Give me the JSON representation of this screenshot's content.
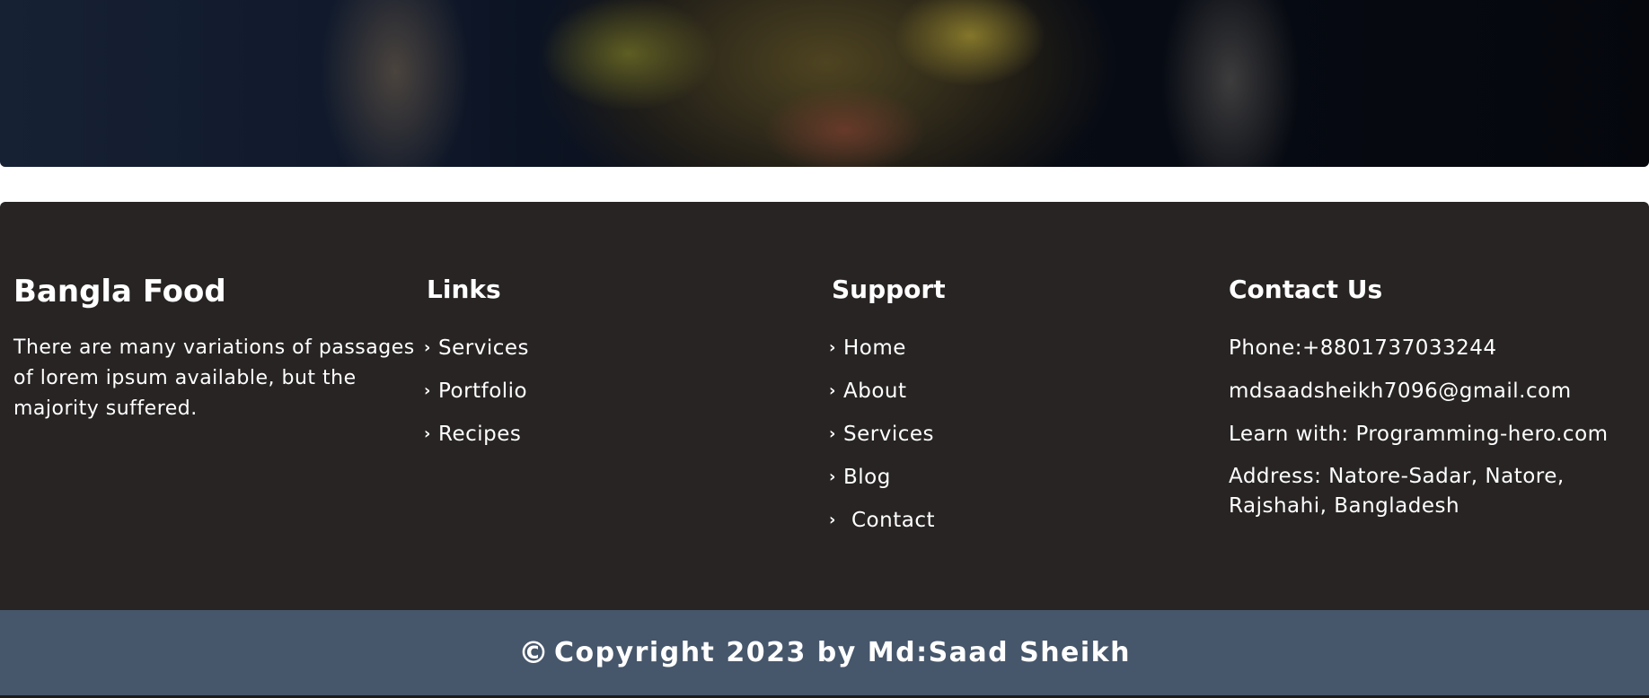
{
  "footer": {
    "brand": {
      "title": "Bangla Food",
      "description": "There are many variations of passages of lorem ipsum available, but the majority suffered."
    },
    "links": {
      "title": "Links",
      "items": [
        "Services",
        "Portfolio",
        "Recipes"
      ]
    },
    "support": {
      "title": "Support",
      "items": [
        "Home",
        "About",
        "Services",
        "Blog",
        "Contact"
      ]
    },
    "contact": {
      "title": "Contact Us",
      "phone": "Phone:+8801737033244",
      "email": "mdsaadsheikh7096@gmail.com",
      "learn": "Learn with: Programming-hero.com",
      "address": "Address: Natore-Sadar, Natore, Rajshahi, Bangladesh"
    }
  },
  "copyright": {
    "symbol": "©",
    "text": "Copyright 2023 by Md:Saad Sheikh"
  },
  "icons": {
    "chevron": "chevron-right-icon"
  },
  "colors": {
    "footer_bg": "#282424",
    "copyright_bg": "#46566b",
    "text": "#ffffff"
  }
}
